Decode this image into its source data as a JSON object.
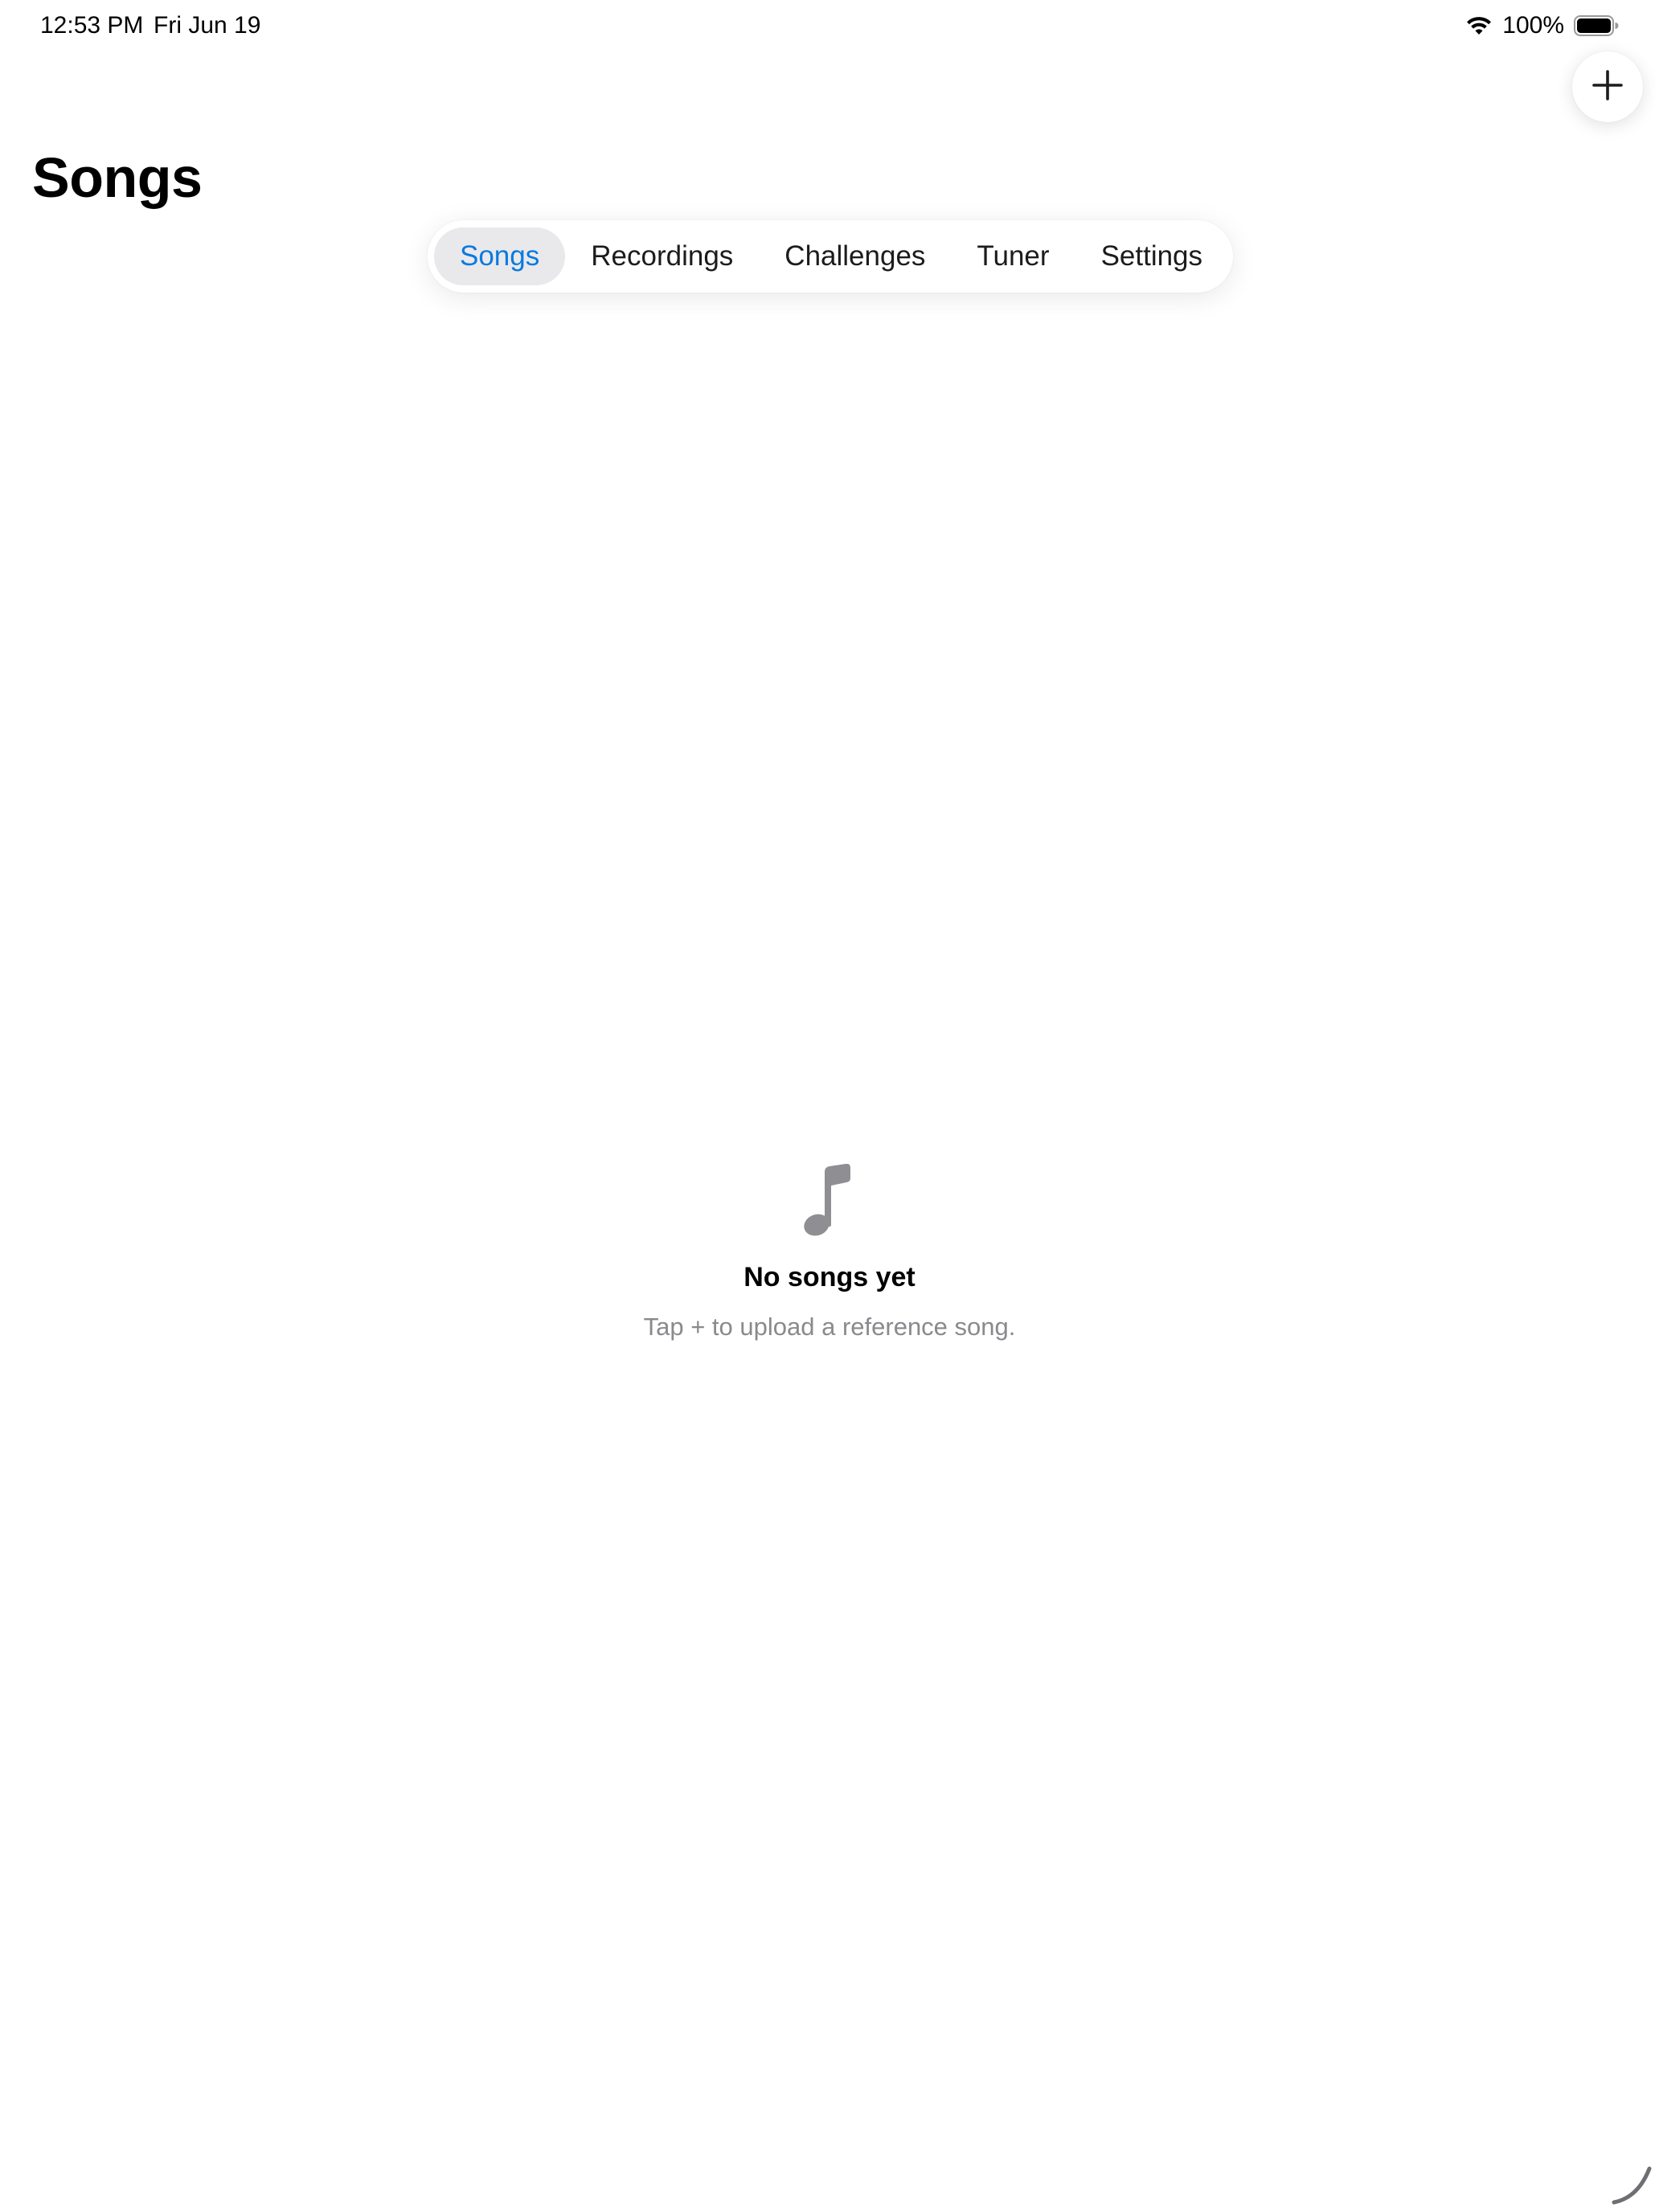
{
  "status_bar": {
    "time": "12:53 PM",
    "date": "Fri Jun 19",
    "battery_percent": "100%",
    "icons": [
      "wifi-icon",
      "battery-icon"
    ]
  },
  "header": {
    "title": "Songs",
    "add_button_icon": "plus-icon"
  },
  "tabs": [
    {
      "label": "Songs",
      "active": true
    },
    {
      "label": "Recordings",
      "active": false
    },
    {
      "label": "Challenges",
      "active": false
    },
    {
      "label": "Tuner",
      "active": false
    },
    {
      "label": "Settings",
      "active": false
    }
  ],
  "empty_state": {
    "icon": "music-note-icon",
    "title": "No songs yet",
    "subtitle": "Tap + to upload a reference song."
  },
  "colors": {
    "accent": "#0a7ae0",
    "active_tab_background": "#e9e9eb",
    "secondary_text": "#8a8a8e",
    "icon_gray": "#8e8e93"
  }
}
